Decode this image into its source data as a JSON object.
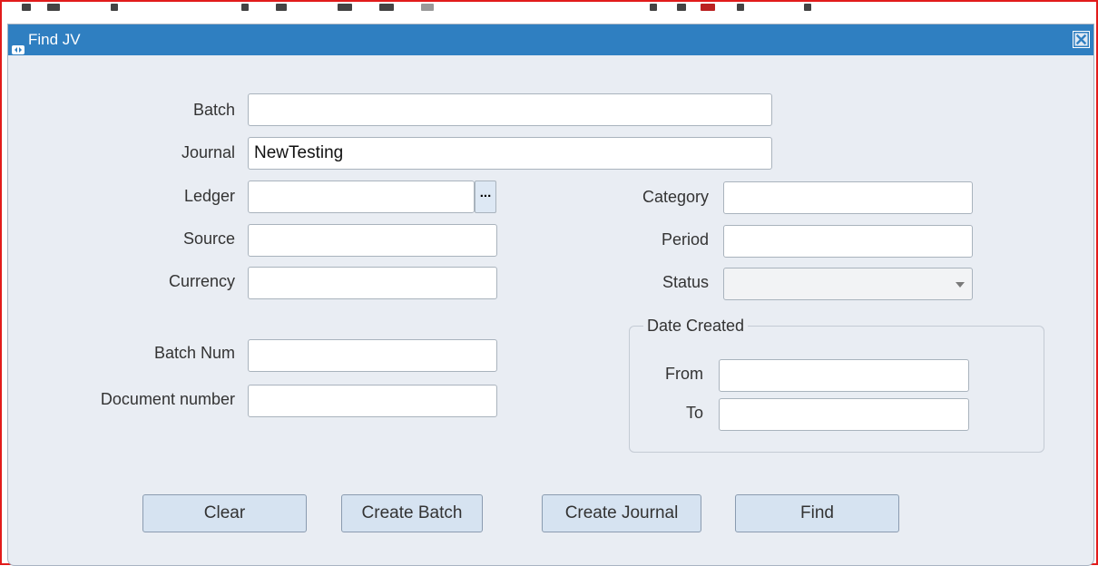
{
  "window": {
    "title": "Find JV"
  },
  "form": {
    "batch": {
      "label": "Batch",
      "value": ""
    },
    "journal": {
      "label": "Journal",
      "value": "NewTesting"
    },
    "ledger": {
      "label": "Ledger",
      "value": "",
      "lov_label": "..."
    },
    "source": {
      "label": "Source",
      "value": ""
    },
    "currency": {
      "label": "Currency",
      "value": ""
    },
    "category": {
      "label": "Category",
      "value": ""
    },
    "period": {
      "label": "Period",
      "value": ""
    },
    "status": {
      "label": "Status",
      "value": ""
    },
    "batch_num": {
      "label": "Batch Num",
      "value": ""
    },
    "document_number": {
      "label": "Document number",
      "value": ""
    },
    "date_created": {
      "title": "Date Created",
      "from": {
        "label": "From",
        "value": ""
      },
      "to": {
        "label": "To",
        "value": ""
      }
    }
  },
  "buttons": {
    "clear": "Clear",
    "create_batch": "Create Batch",
    "create_journal": "Create Journal",
    "find": "Find"
  },
  "colors": {
    "titlebar": "#2f7fc1",
    "window_bg": "#e9edf3",
    "button_bg": "#d6e3f1",
    "outer_border": "#e21b1b"
  },
  "icons": {
    "app": "oracle-forms-window-icon",
    "close": "close-icon",
    "dropdown": "chevron-down-icon"
  }
}
